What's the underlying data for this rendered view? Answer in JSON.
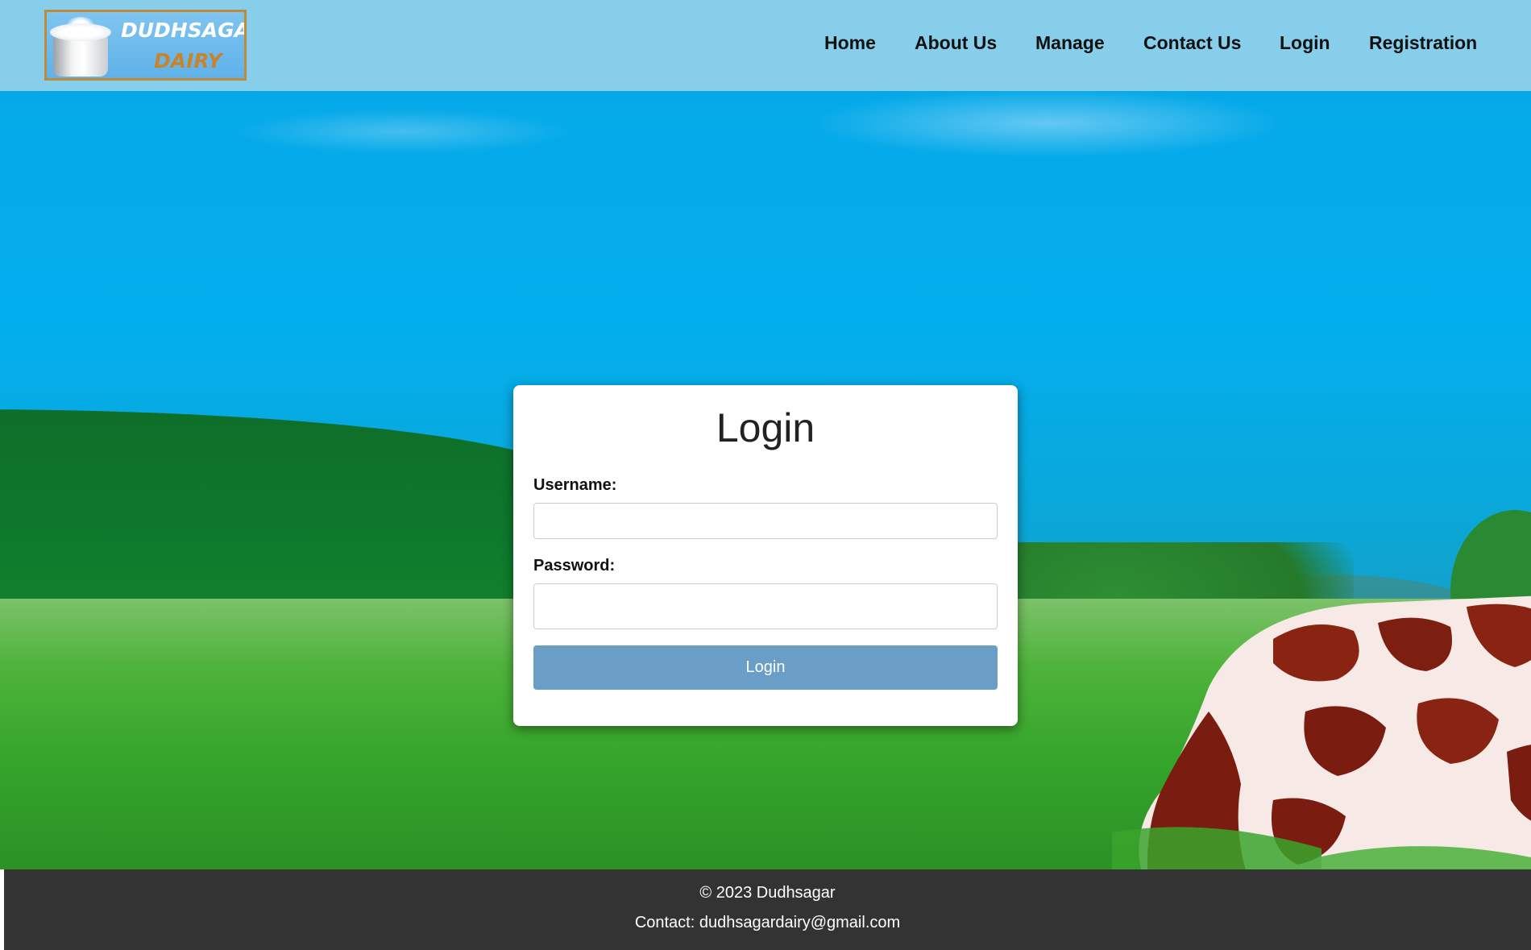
{
  "header": {
    "logo": {
      "line1": "DUDHSAGAR",
      "line2": "DAIRY"
    },
    "nav": [
      {
        "label": "Home"
      },
      {
        "label": "About Us"
      },
      {
        "label": "Manage"
      },
      {
        "label": "Contact Us"
      },
      {
        "label": "Login"
      },
      {
        "label": "Registration"
      }
    ],
    "background_color": "#87ceeb"
  },
  "login_form": {
    "title": "Login",
    "username_label": "Username:",
    "username_value": "",
    "password_label": "Password:",
    "password_value": "",
    "submit_label": "Login",
    "button_color": "#6a9ec7"
  },
  "footer": {
    "copyright": "© 2023 Dudhsagar",
    "contact": "Contact: dudhsagardairy@gmail.com",
    "background_color": "#333333"
  }
}
